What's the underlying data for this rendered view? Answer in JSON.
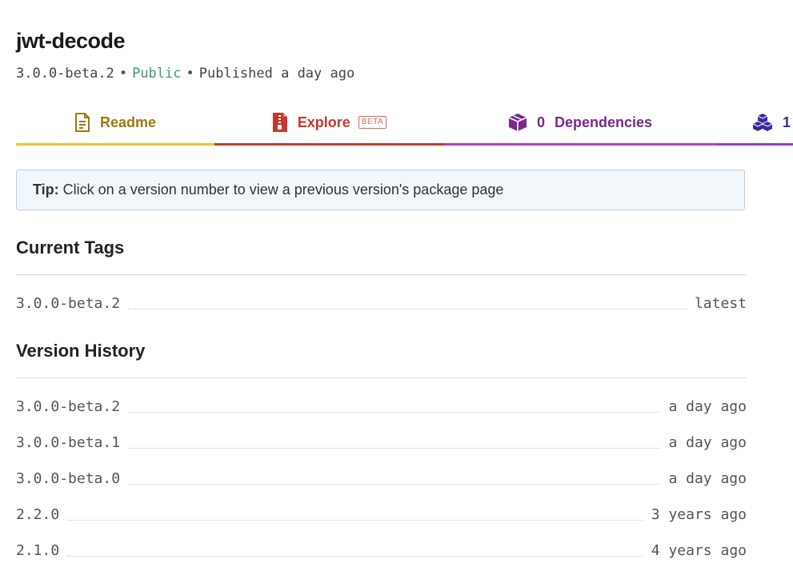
{
  "package": {
    "name": "jwt-decode",
    "version": "3.0.0-beta.2",
    "visibility": "Public",
    "published": "Published a day ago",
    "separator": "•"
  },
  "tabs": {
    "readme": {
      "label": "Readme",
      "icon": "file-text-icon",
      "color": "#9b7a12"
    },
    "explore": {
      "label": "Explore",
      "badge": "BETA",
      "icon": "file-zip-icon",
      "color": "#c8372d"
    },
    "dependencies": {
      "count": "0",
      "label": "Dependencies",
      "icon": "box-icon",
      "color": "#7a2a8a"
    },
    "dependents": {
      "label": "1",
      "icon": "boxes-icon",
      "color": "#3b2aa3"
    }
  },
  "tip": {
    "label": "Tip:",
    "text": "Click on a version number to view a previous version's package page"
  },
  "current_tags": {
    "heading": "Current Tags",
    "rows": [
      {
        "version": "3.0.0-beta.2",
        "tag": "latest"
      }
    ]
  },
  "version_history": {
    "heading": "Version History",
    "rows": [
      {
        "version": "3.0.0-beta.2",
        "when": "a day ago"
      },
      {
        "version": "3.0.0-beta.1",
        "when": "a day ago"
      },
      {
        "version": "3.0.0-beta.0",
        "when": "a day ago"
      },
      {
        "version": "2.2.0",
        "when": "3 years ago"
      },
      {
        "version": "2.1.0",
        "when": "4 years ago"
      }
    ]
  },
  "colors": {
    "public": "#3a9d6b",
    "readme_accent": "#f1c232",
    "explore_accent": "#c8372d",
    "deps_accent": "#b43cd6",
    "tip_bg": "#f2f7fb"
  }
}
